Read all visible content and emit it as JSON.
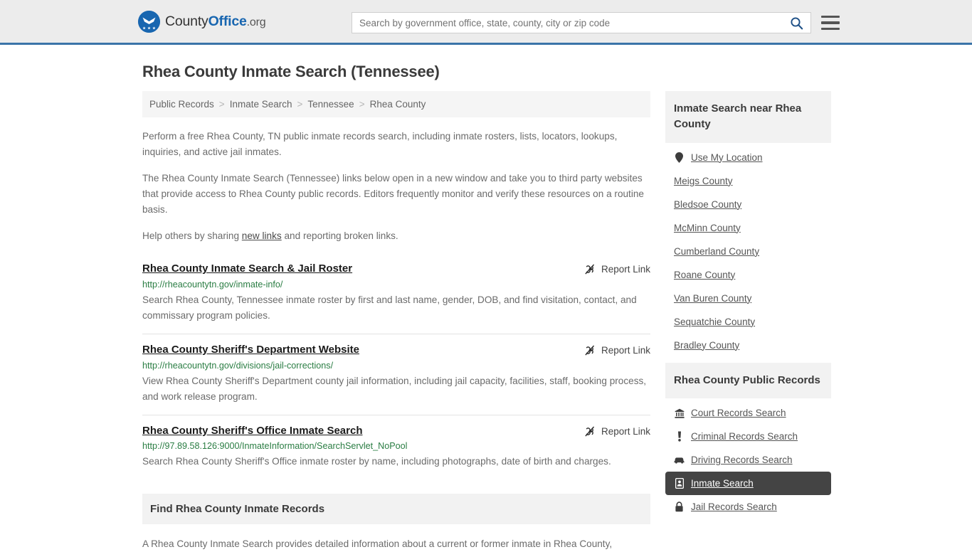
{
  "header": {
    "logo_text_1": "County",
    "logo_text_2": "Office",
    "logo_tld": ".org",
    "search_placeholder": "Search by government office, state, county, city or zip code",
    "search_value": "",
    "search_icon": "search-icon",
    "menu_icon": "hamburger-menu-icon",
    "accent_color": "#3a74a8",
    "background_color": "#ececec"
  },
  "page": {
    "title": "Rhea County Inmate Search (Tennessee)"
  },
  "breadcrumb": {
    "items": [
      {
        "label": "Public Records"
      },
      {
        "label": "Inmate Search"
      },
      {
        "label": "Tennessee"
      },
      {
        "label": "Rhea County"
      }
    ],
    "separator": ">"
  },
  "intro": {
    "paragraph_1": "Perform a free Rhea County, TN public inmate records search, including inmate rosters, lists, locators, lookups, inquiries, and active jail inmates.",
    "paragraph_2": "The Rhea County Inmate Search (Tennessee) links below open in a new window and take you to third party websites that provide access to Rhea County public records. Editors frequently monitor and verify these resources on a routine basis.",
    "paragraph_3_before": "Help others by sharing ",
    "paragraph_3_link": "new links",
    "paragraph_3_after": " and reporting broken links."
  },
  "results": {
    "report_label": "Report Link",
    "report_icon": "broken-link-icon",
    "items": [
      {
        "title": "Rhea County Inmate Search & Jail Roster",
        "url": "http://rheacountytn.gov/inmate-info/",
        "description": "Search Rhea County, Tennessee inmate roster by first and last name, gender, DOB, and find visitation, contact, and commissary program policies."
      },
      {
        "title": "Rhea County Sheriff's Department Website",
        "url": "http://rheacountytn.gov/divisions/jail-corrections/",
        "description": "View Rhea County Sheriff's Department county jail information, including jail capacity, facilities, staff, booking process, and work release program."
      },
      {
        "title": "Rhea County Sheriff's Office Inmate Search",
        "url": "http://97.89.58.126:9000/InmateInformation/SearchServlet_NoPool",
        "description": "Search Rhea County Sheriff's Office inmate roster by name, including photographs, date of birth and charges."
      }
    ]
  },
  "find_section": {
    "heading": "Find Rhea County Inmate Records",
    "paragraph": "A Rhea County Inmate Search provides detailed information about a current or former inmate in Rhea County,"
  },
  "sidebar": {
    "nearby": {
      "heading": "Inmate Search near Rhea County",
      "items": [
        {
          "label": "Use My Location",
          "icon": "map-pin-icon"
        },
        {
          "label": "Meigs County",
          "icon": ""
        },
        {
          "label": "Bledsoe County",
          "icon": ""
        },
        {
          "label": "McMinn County",
          "icon": ""
        },
        {
          "label": "Cumberland County",
          "icon": ""
        },
        {
          "label": "Roane County",
          "icon": ""
        },
        {
          "label": "Van Buren County",
          "icon": ""
        },
        {
          "label": "Sequatchie County",
          "icon": ""
        },
        {
          "label": "Bradley County",
          "icon": ""
        }
      ]
    },
    "public_records": {
      "heading": "Rhea County Public Records",
      "active_color": "#444444",
      "items": [
        {
          "label": "Court Records Search",
          "icon": "courthouse-icon",
          "active": false
        },
        {
          "label": "Criminal Records Search",
          "icon": "exclamation-icon",
          "active": false
        },
        {
          "label": "Driving Records Search",
          "icon": "car-icon",
          "active": false
        },
        {
          "label": "Inmate Search",
          "icon": "id-badge-icon",
          "active": true
        },
        {
          "label": "Jail Records Search",
          "icon": "lock-icon",
          "active": false
        }
      ]
    }
  }
}
